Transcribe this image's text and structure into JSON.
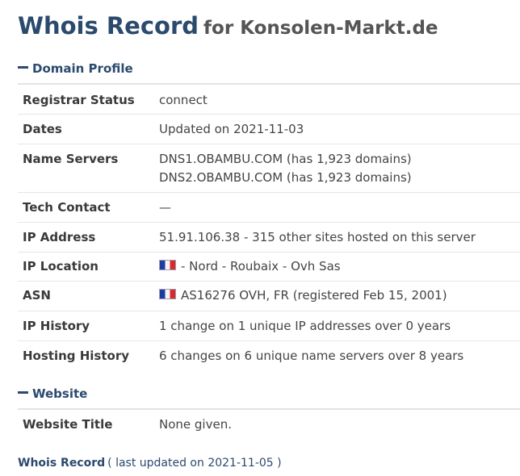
{
  "header": {
    "title": "Whois Record",
    "subtitle": "for Konsolen-Markt.de"
  },
  "domain_profile": {
    "heading": "Domain Profile",
    "rows": {
      "registrar_status": {
        "label": "Registrar Status",
        "value": "connect"
      },
      "dates": {
        "label": "Dates",
        "value": "Updated on 2021-11-03"
      },
      "name_servers": {
        "label": "Name Servers",
        "value1": "DNS1.OBAMBU.COM (has 1,923 domains)",
        "value2": "DNS2.OBAMBU.COM (has 1,923 domains)"
      },
      "tech_contact": {
        "label": "Tech Contact",
        "value": "—"
      },
      "ip_address": {
        "label": "IP Address",
        "value": "51.91.106.38 - 315 other sites hosted on this server"
      },
      "ip_location": {
        "label": "IP Location",
        "value": "- Nord - Roubaix - Ovh Sas",
        "flag": "france-flag-icon"
      },
      "asn": {
        "label": "ASN",
        "value": "AS16276 OVH, FR (registered Feb 15, 2001)",
        "flag": "france-flag-icon"
      },
      "ip_history": {
        "label": "IP History",
        "value": "1 change on 1 unique IP addresses over 0 years"
      },
      "hosting_history": {
        "label": "Hosting History",
        "value": "6 changes on 6 unique name servers over 8 years"
      }
    }
  },
  "website": {
    "heading": "Website",
    "rows": {
      "website_title": {
        "label": "Website Title",
        "value": "None given."
      }
    }
  },
  "footer": {
    "title": "Whois Record",
    "note": "( last updated on 2021-11-05 )"
  },
  "colors": {
    "heading_blue": "#2b4a6e",
    "text": "#444444"
  }
}
